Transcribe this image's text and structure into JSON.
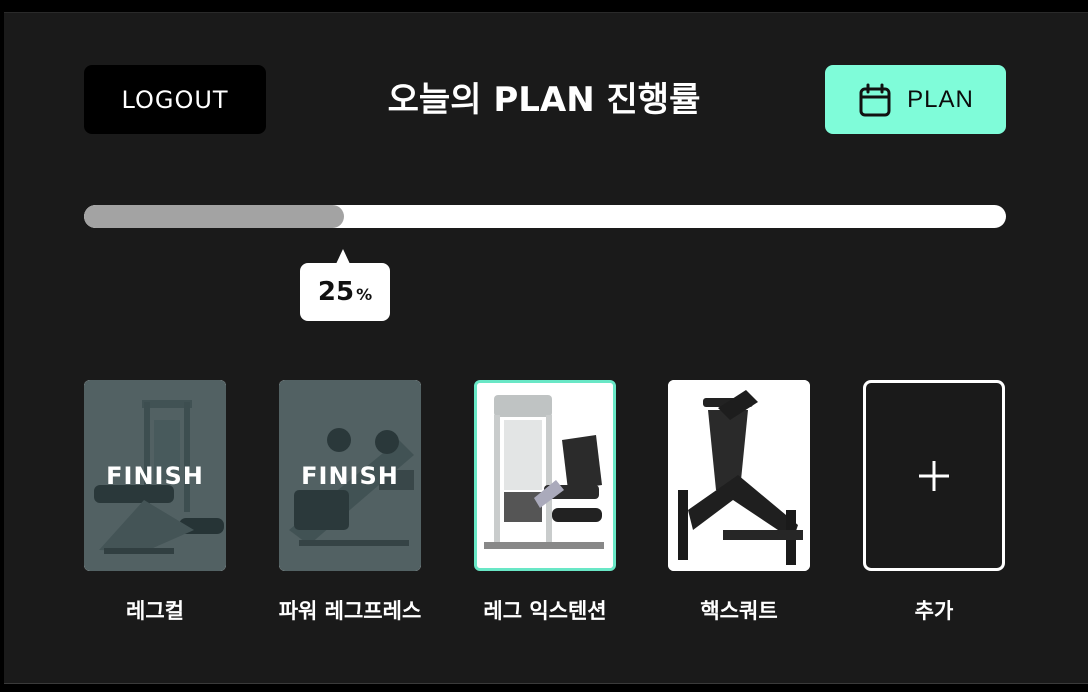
{
  "header": {
    "logout_label": "LOGOUT",
    "title": "오늘의 PLAN 진행률",
    "plan_label": "PLAN",
    "plan_icon": "calendar-icon"
  },
  "progress": {
    "value": 25,
    "value_text": "25",
    "unit": "%"
  },
  "exercises": [
    {
      "name": "레그컬",
      "status": "FINISH",
      "finished": true
    },
    {
      "name": "파워 레그프레스",
      "status": "FINISH",
      "finished": true
    },
    {
      "name": "레그 익스텐션",
      "status": "",
      "finished": false,
      "selected": true
    },
    {
      "name": "핵스쿼트",
      "status": "",
      "finished": false
    }
  ],
  "add_card": {
    "label": "추가",
    "icon": "plus-icon"
  },
  "colors": {
    "accent": "#7ffcd9",
    "selected_border": "#69e7c6",
    "background": "#1a1a1a",
    "progress_fill": "#a3a3a3"
  }
}
